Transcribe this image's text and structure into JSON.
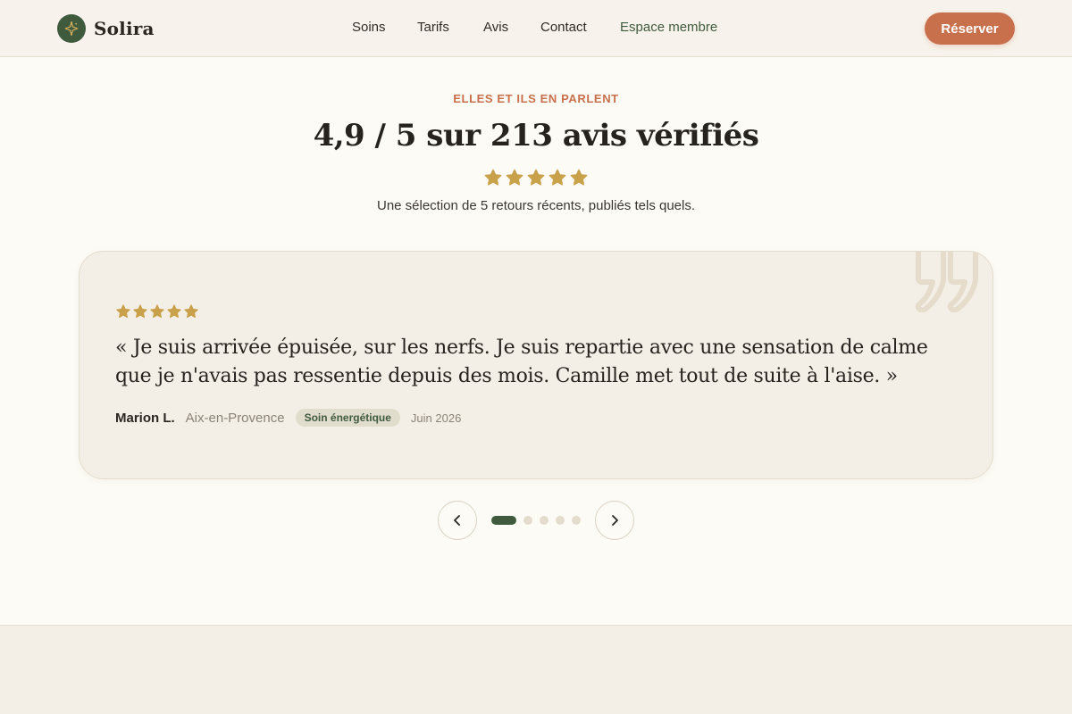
{
  "brand": {
    "name": "Solira",
    "accent": "#3f5a3c",
    "cta_color": "#c8704c",
    "icon": "sparkle-icon"
  },
  "nav": {
    "items": [
      {
        "label": "Soins"
      },
      {
        "label": "Tarifs"
      },
      {
        "label": "Avis"
      },
      {
        "label": "Contact"
      },
      {
        "label": "Espace membre"
      }
    ],
    "reserve_label": "Réserver"
  },
  "testimonials": {
    "eyebrow": "ELLES ET ILS EN PARLENT",
    "title": "4,9 / 5 sur 213 avis vérifiés",
    "rating": 5,
    "subtitle": "Une sélection de 5 retours récents, publiés tels quels.",
    "current": {
      "rating": 5,
      "quote": "« Je suis arrivée épuisée, sur les nerfs. Je suis repartie avec une sensation de calme que je n'avais pas ressentie depuis des mois. Camille met tout de suite à l'aise. »",
      "author": "Marion L.",
      "city": "Aix-en-Provence",
      "service": "Soin énergétique",
      "date": "Juin 2026"
    },
    "total_slides": 5,
    "active_slide": 1,
    "star_color": "#c9a14a"
  }
}
